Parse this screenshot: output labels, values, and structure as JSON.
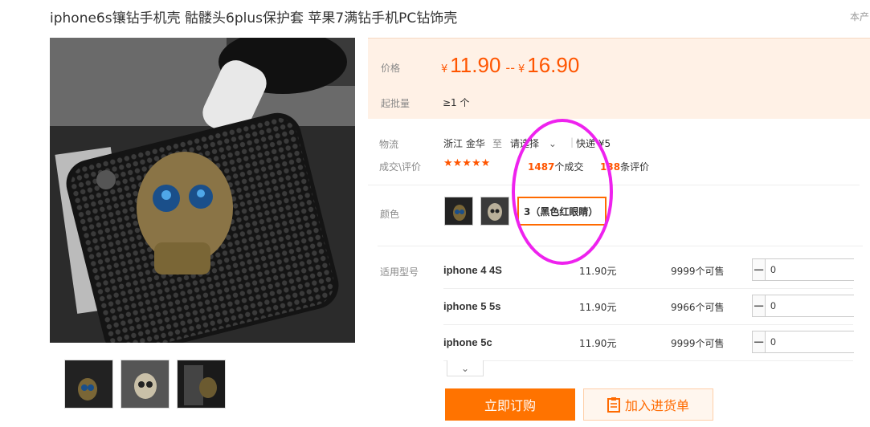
{
  "title": "iphone6s镶钻手机壳 骷髅头6plus保护套 苹果7满钻手机PC钻饰壳",
  "corner_note": "本产",
  "price": {
    "label": "价格",
    "currency": "¥",
    "low": "11.90",
    "separator": "--",
    "high": "16.90"
  },
  "moq": {
    "label": "起批量",
    "value": "≥1 个"
  },
  "logistics": {
    "label": "物流",
    "origin": "浙江 金华",
    "to": "至",
    "destination": "请选择",
    "shipping": "快递 ¥5"
  },
  "reviews": {
    "label": "成交\\评价",
    "stars": "★★★★★",
    "deals_count": "1487",
    "deals_unit": "个成交",
    "review_count": "138",
    "review_unit": "条评价"
  },
  "colors": {
    "label": "颜色",
    "selected": "3（黑色红眼睛）"
  },
  "models": {
    "label": "适用型号",
    "rows": [
      {
        "name": "iphone 4 4S",
        "price": "11.90元",
        "stock": "9999个可售",
        "qty": "0"
      },
      {
        "name": "iphone 5 5s",
        "price": "11.90元",
        "stock": "9966个可售",
        "qty": "0"
      },
      {
        "name": "iphone 5c",
        "price": "11.90元",
        "stock": "9999个可售",
        "qty": "0"
      }
    ]
  },
  "actions": {
    "buy_now": "立即订购",
    "add_to_list": "加入进货单"
  },
  "colors_accent": {
    "brand": "#ff7300",
    "annotation": "#ee22ee"
  }
}
